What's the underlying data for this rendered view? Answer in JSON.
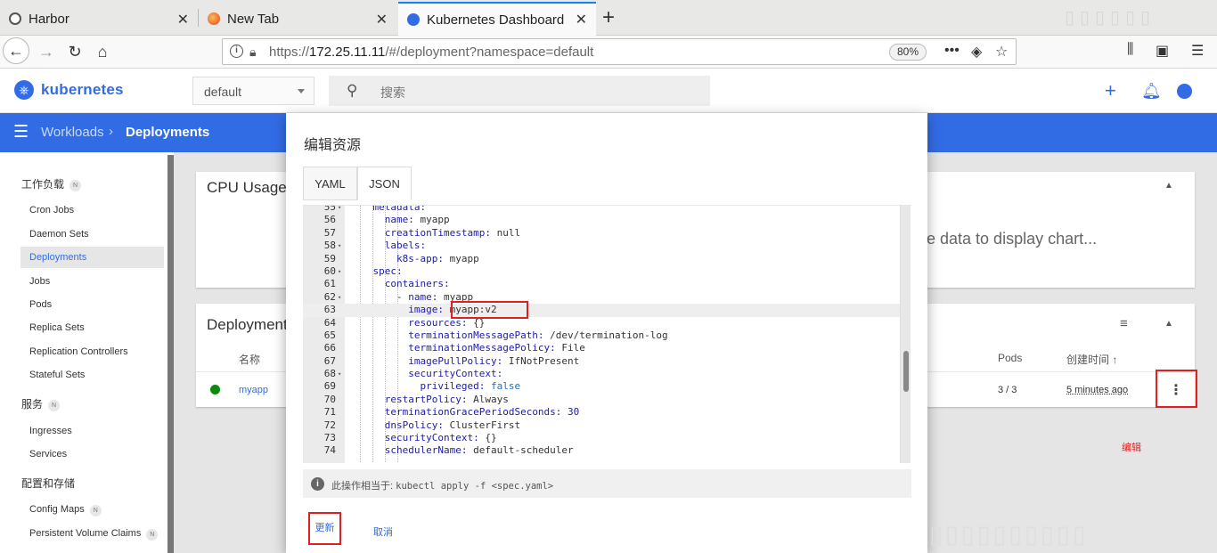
{
  "browser": {
    "tabs": [
      {
        "title": "Harbor",
        "active": false
      },
      {
        "title": "New Tab",
        "active": false
      },
      {
        "title": "Kubernetes Dashboard",
        "active": true
      }
    ],
    "url_prefix": "https://",
    "url_host": "172.25.11.11",
    "url_path": "/#/deployment?namespace=default",
    "zoom": "80%"
  },
  "dashboard": {
    "brand": "kubernetes",
    "namespace": "default",
    "search_placeholder": "搜索",
    "breadcrumb": {
      "parent": "Workloads",
      "current": "Deployments"
    }
  },
  "sidebar": {
    "sections": [
      {
        "title": "工作负载",
        "badge": "N",
        "items": [
          "Cron Jobs",
          "Daemon Sets",
          "Deployments",
          "Jobs",
          "Pods",
          "Replica Sets",
          "Replication Controllers",
          "Stateful Sets"
        ]
      },
      {
        "title": "服务",
        "badge": "N",
        "items": [
          "Ingresses",
          "Services"
        ]
      },
      {
        "title": "配置和存储",
        "items": [
          "Config Maps",
          "Persistent Volume Claims"
        ]
      }
    ],
    "item_badges": {
      "Config Maps": "N",
      "Persistent Volume Claims": "N"
    },
    "active_item": "Deployments"
  },
  "main": {
    "cpu_card_title": "CPU Usage",
    "chart_empty_text": "e data to display chart...",
    "deployments_card_title": "Deployments",
    "columns": {
      "name": "名称",
      "pods": "Pods",
      "created": "创建时间 ↑"
    },
    "rows": [
      {
        "name": "myapp",
        "pods": "3 / 3",
        "created": "5 minutes ago",
        "status_color": "#0b8a0b"
      }
    ],
    "annotation": "编辑"
  },
  "modal": {
    "title": "编辑资源",
    "tabs": [
      "YAML",
      "JSON"
    ],
    "active_tab": "JSON",
    "lines": [
      {
        "n": "55",
        "text": "    metadata:"
      },
      {
        "n": "56",
        "text": "      name: myapp"
      },
      {
        "n": "57",
        "text": "      creationTimestamp: null"
      },
      {
        "n": "58",
        "text": "      labels:"
      },
      {
        "n": "59",
        "text": "        k8s-app: myapp"
      },
      {
        "n": "60",
        "text": "    spec:"
      },
      {
        "n": "61",
        "text": "      containers:"
      },
      {
        "n": "62",
        "text": "        - name: myapp"
      },
      {
        "n": "63",
        "text": "          image: myapp:v2"
      },
      {
        "n": "64",
        "text": "          resources: {}"
      },
      {
        "n": "65",
        "text": "          terminationMessagePath: /dev/termination-log"
      },
      {
        "n": "66",
        "text": "          terminationMessagePolicy: File"
      },
      {
        "n": "67",
        "text": "          imagePullPolicy: IfNotPresent"
      },
      {
        "n": "68",
        "text": "          securityContext:"
      },
      {
        "n": "69",
        "text": "            privileged: false"
      },
      {
        "n": "70",
        "text": "      restartPolicy: Always"
      },
      {
        "n": "71",
        "text": "      terminationGracePeriodSeconds: 30"
      },
      {
        "n": "72",
        "text": "      dnsPolicy: ClusterFirst"
      },
      {
        "n": "73",
        "text": "      securityContext: {}"
      },
      {
        "n": "74",
        "text": "      schedulerName: default-scheduler"
      }
    ],
    "fold_lines": [
      "55",
      "58",
      "60",
      "62",
      "68"
    ],
    "highlighted_line": "63",
    "info_prefix": "此操作相当于: ",
    "info_command": "kubectl apply -f <spec.yaml>",
    "update_label": "更新",
    "cancel_label": "取消"
  },
  "colors": {
    "accent": "#326ce5",
    "highlight_box": "#e02020",
    "tab_indicator": "#0a84ff"
  }
}
